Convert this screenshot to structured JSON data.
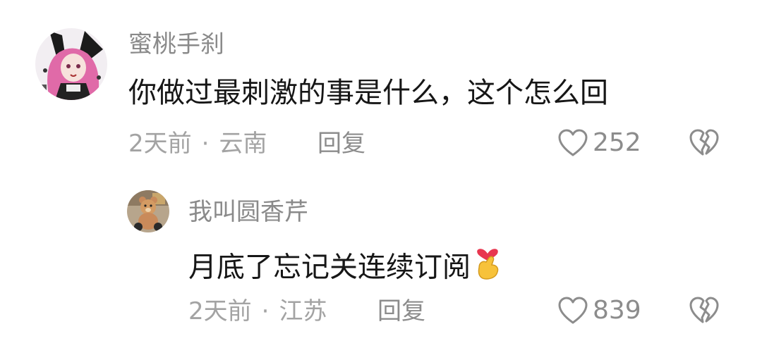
{
  "comments": [
    {
      "username": "蜜桃手刹",
      "text": "你做过最刺激的事是什么，这个怎么回",
      "time": "2天前",
      "separator": "·",
      "location": "云南",
      "reply_label": "回复",
      "likes": "252",
      "avatar_icon": "anime-girl-avatar",
      "like_icon": "heart-outline-icon",
      "dislike_icon": "broken-heart-icon"
    },
    {
      "username": "我叫圆香芹",
      "text": "月底了忘记关连续订阅",
      "emoji": "finger-heart-emoji",
      "time": "2天前",
      "separator": "·",
      "location": "江苏",
      "reply_label": "回复",
      "likes": "839",
      "avatar_icon": "teddy-bear-avatar",
      "like_icon": "heart-outline-icon",
      "dislike_icon": "broken-heart-icon"
    }
  ],
  "colors": {
    "username": "#8a8a8a",
    "text": "#161616",
    "meta": "#a3a3a3",
    "icon": "#8c8c8c"
  }
}
